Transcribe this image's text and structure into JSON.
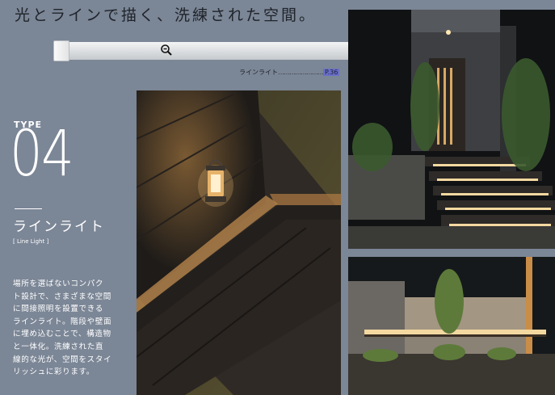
{
  "headline": "光とラインで描く、洗練された空間。",
  "reference": {
    "label": "ラインライト",
    "dots": "……………………",
    "page": "P.36"
  },
  "type_block": {
    "label": "TYPE",
    "number": "04",
    "name": "ラインライト",
    "name_en": "[ Line Light ]"
  },
  "description_lines": [
    "場所を選ばないコンパク",
    "ト設計で、さまざまな空間",
    "に間接照明を設置できる",
    "ラインライト。階段や壁面",
    "に埋め込むことで、構造物",
    "と一体化。洗練された直",
    "線的な光が、空間をスタイ",
    "リッシュに彩ります。"
  ],
  "photos": {
    "deck": "deck-with-lantern-photo",
    "stairs": "lit-stairs-entrance-photo",
    "wall": "lit-garden-wall-photo"
  },
  "colors": {
    "page_background": "#7b8696",
    "headline_text": "#20242b",
    "page_ref_highlight": "#6a6fc7",
    "light_warm": "#f3d8a0"
  }
}
